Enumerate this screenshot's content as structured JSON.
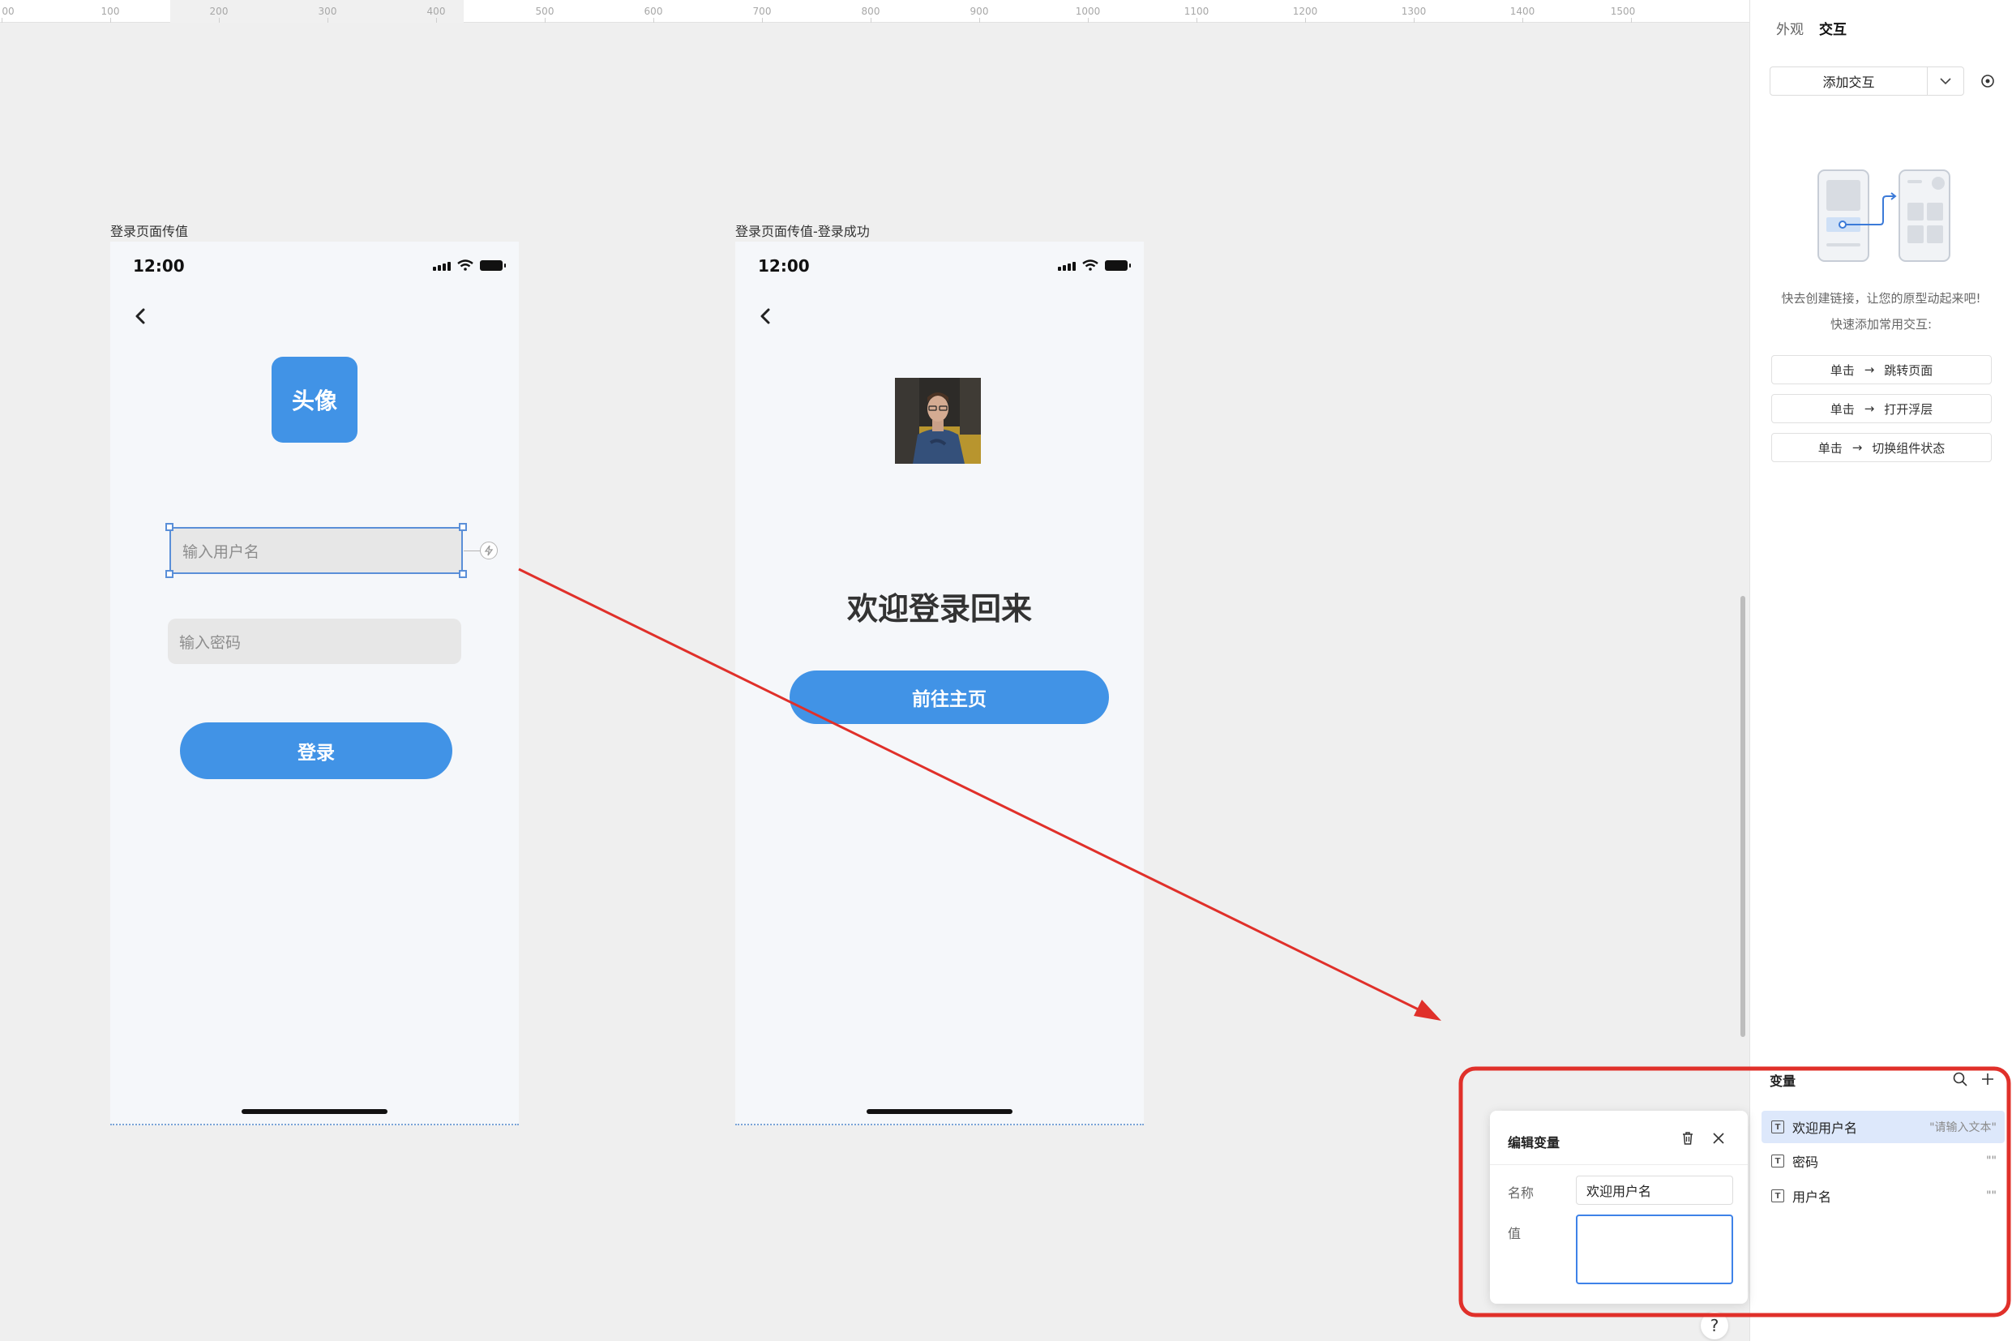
{
  "ruler": {
    "ticks": [
      "00",
      "100",
      "200",
      "300",
      "400",
      "500",
      "600",
      "700",
      "800",
      "900",
      "1000",
      "1100",
      "1200",
      "1300",
      "1400",
      "1500"
    ]
  },
  "frame_left": {
    "label": "登录页面传值",
    "time": "12:00",
    "avatar_text": "头像",
    "username_placeholder": "输入用户名",
    "password_placeholder": "输入密码",
    "login_button": "登录"
  },
  "frame_right": {
    "label": "登录页面传值-登录成功",
    "time": "12:00",
    "welcome_text": "欢迎登录回来",
    "home_button": "前往主页"
  },
  "panel": {
    "tabs": {
      "appearance": "外观",
      "interaction": "交互"
    },
    "add_interaction": "添加交互",
    "hint_line1": "快去创建链接，让您的原型动起来吧!",
    "hint_line2": "快速添加常用交互:",
    "quick_actions": [
      {
        "trigger": "单击",
        "arrow": "→",
        "action": "跳转页面"
      },
      {
        "trigger": "单击",
        "arrow": "→",
        "action": "打开浮层"
      },
      {
        "trigger": "单击",
        "arrow": "→",
        "action": "切换组件状态"
      }
    ],
    "variables": {
      "title": "变量",
      "items": [
        {
          "name": "欢迎用户名",
          "value": "\"请输入文本\""
        },
        {
          "name": "密码",
          "value": "\"\""
        },
        {
          "name": "用户名",
          "value": "\"\""
        }
      ]
    }
  },
  "editor": {
    "title": "编辑变量",
    "name_label": "名称",
    "name_value": "欢迎用户名",
    "value_label": "值",
    "value_value": ""
  },
  "help": {
    "label": "?"
  },
  "colors": {
    "accent": "#4193e6",
    "annotation": "#e0302a",
    "selection": "#5a8fd8"
  }
}
